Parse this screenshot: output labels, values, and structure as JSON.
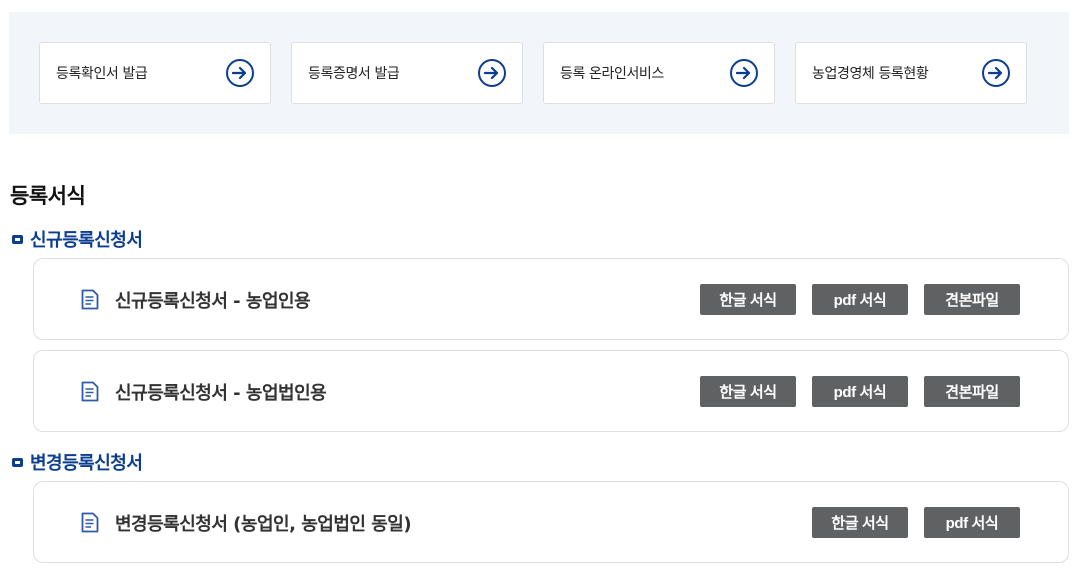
{
  "quick_links": [
    {
      "label": "등록확인서 발급",
      "icon": "arrow-right-icon"
    },
    {
      "label": "등록증명서 발급",
      "icon": "arrow-right-icon"
    },
    {
      "label": "등록 온라인서비스",
      "icon": "arrow-right-icon"
    },
    {
      "label": "농업경영체 등록현황",
      "icon": "arrow-right-icon"
    }
  ],
  "section_title": "등록서식",
  "groups": [
    {
      "title": "신규등록신청서",
      "forms": [
        {
          "name": "신규등록신청서 - 농업인용",
          "buttons": [
            "한글 서식",
            "pdf 서식",
            "견본파일"
          ]
        },
        {
          "name": "신규등록신청서 - 농업법인용",
          "buttons": [
            "한글 서식",
            "pdf 서식",
            "견본파일"
          ]
        }
      ]
    },
    {
      "title": "변경등록신청서",
      "forms": [
        {
          "name": "변경등록신청서 (농업인, 농업법인 동일)",
          "buttons": [
            "한글 서식",
            "pdf 서식"
          ]
        }
      ]
    }
  ],
  "colors": {
    "accent": "#0b3d91",
    "button_bg": "#5f6163",
    "panel_bg": "#f2f5f9"
  }
}
